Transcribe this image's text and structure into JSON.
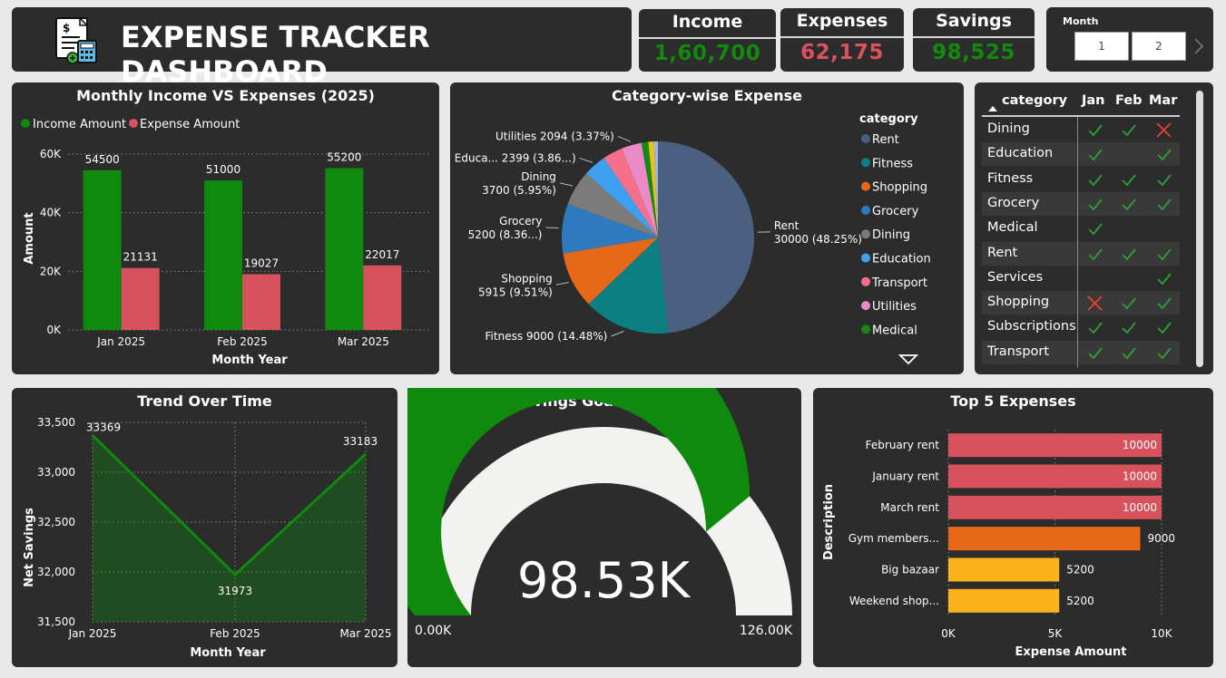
{
  "header": {
    "title": "EXPENSE TRACKER DASHBOARD",
    "icon": "invoice-calculator-icon"
  },
  "kpis": [
    {
      "label": "Income",
      "value": "1,60,700",
      "color": "#118a0e"
    },
    {
      "label": "Expenses",
      "value": "62,175",
      "color": "#d9535e"
    },
    {
      "label": "Savings",
      "value": "98,525",
      "color": "#118a0e"
    }
  ],
  "slicer": {
    "label": "Month",
    "options": [
      "1",
      "2"
    ],
    "next_icon": "chevron-right-icon"
  },
  "colors": {
    "income": "#0f8a0f",
    "expense": "#d6525d",
    "panel": "#2c2c2c"
  },
  "chart_data": [
    {
      "id": "monthly",
      "type": "bar",
      "title": "Monthly Income VS Expenses (2025)",
      "xlabel": "Month Year",
      "ylabel": "Amount",
      "categories": [
        "Jan 2025",
        "Feb 2025",
        "Mar 2025"
      ],
      "series": [
        {
          "name": "Income Amount",
          "color": "#0f8a0f",
          "values": [
            54500,
            51000,
            55200
          ]
        },
        {
          "name": "Expense Amount",
          "color": "#d6525d",
          "values": [
            21131,
            19027,
            22017
          ]
        }
      ],
      "ylim": [
        0,
        60000
      ],
      "yticks": [
        "0K",
        "20K",
        "40K",
        "60K"
      ],
      "grid": true,
      "legend": "top-left"
    },
    {
      "id": "category",
      "type": "pie",
      "title": "Category-wise Expense",
      "legend_title": "category",
      "slices": [
        {
          "name": "Rent",
          "value": 30000,
          "pct": "48.25%",
          "color": "#4b5f80",
          "label": "Rent 30000 (48.25%)"
        },
        {
          "name": "Fitness",
          "value": 9000,
          "pct": "14.48%",
          "color": "#0c7f82",
          "label": "Fitness 9000 (14.48%)"
        },
        {
          "name": "Shopping",
          "value": 5915,
          "pct": "9.51%",
          "color": "#e8681a",
          "label": "Shopping 5915 (9.51%)"
        },
        {
          "name": "Grocery",
          "value": 5200,
          "pct": "8.36...",
          "color": "#2d7bbd",
          "label": "Grocery 5200 (8.36...)"
        },
        {
          "name": "Dining",
          "value": 3700,
          "pct": "5.95%",
          "color": "#7b7b7b",
          "label": "Dining 3700 (5.95%)"
        },
        {
          "name": "Education",
          "value": 2399,
          "pct": "3.86...",
          "color": "#3ea0f0",
          "label": "Educa... 2399 (3.86...)"
        },
        {
          "name": "Transport",
          "value": 2094,
          "pct": "3.37%",
          "color": "#f5718a",
          "label": ""
        },
        {
          "name": "Utilities",
          "value": 2094,
          "pct": "3.37%",
          "color": "#ea8ac9",
          "label": "Utilities 2094 (3.37%)"
        },
        {
          "name": "Medical",
          "value": 700,
          "pct": "1.13%",
          "color": "#138a12",
          "label": ""
        },
        {
          "name": "Services",
          "value": 600,
          "pct": "0.97%",
          "color": "#e8c21a",
          "label": ""
        },
        {
          "name": "Subscriptions",
          "value": 400,
          "pct": "0.64%",
          "color": "#9bb9e6",
          "label": ""
        }
      ],
      "legend_items": [
        "Rent",
        "Fitness",
        "Shopping",
        "Grocery",
        "Dining",
        "Education",
        "Transport",
        "Utilities",
        "Medical"
      ],
      "legend": "right"
    },
    {
      "id": "matrix",
      "type": "table",
      "columns": [
        "category",
        "Jan",
        "Feb",
        "Mar"
      ],
      "rows": [
        {
          "category": "Dining",
          "cells": [
            "check",
            "check",
            "cross"
          ]
        },
        {
          "category": "Education",
          "cells": [
            "check",
            "",
            "check"
          ]
        },
        {
          "category": "Fitness",
          "cells": [
            "check",
            "check",
            "check"
          ]
        },
        {
          "category": "Grocery",
          "cells": [
            "check",
            "check",
            "check"
          ]
        },
        {
          "category": "Medical",
          "cells": [
            "check",
            "",
            ""
          ]
        },
        {
          "category": "Rent",
          "cells": [
            "check",
            "check",
            "check"
          ]
        },
        {
          "category": "Services",
          "cells": [
            "",
            "",
            "check"
          ]
        },
        {
          "category": "Shopping",
          "cells": [
            "cross",
            "check",
            "check"
          ]
        },
        {
          "category": "Subscriptions",
          "cells": [
            "check",
            "check",
            "check"
          ]
        },
        {
          "category": "Transport",
          "cells": [
            "check",
            "check",
            "check"
          ]
        }
      ]
    },
    {
      "id": "trend",
      "type": "area",
      "title": "Trend Over Time",
      "xlabel": "Month Year",
      "ylabel": "Net Savings",
      "x": [
        "Jan 2025",
        "Feb 2025",
        "Mar 2025"
      ],
      "values": [
        33369,
        31973,
        33183
      ],
      "ylim": [
        31500,
        33500
      ],
      "yticks": [
        "31,500",
        "32,000",
        "32,500",
        "33,000",
        "33,500"
      ],
      "color": "#0f8a0f",
      "grid": true
    },
    {
      "id": "gauge",
      "type": "gauge",
      "title": "Savings Goal Progress",
      "value": 98525,
      "value_label": "98.53K",
      "min": 0,
      "max": 126000,
      "min_label": "0.00K",
      "max_label": "126.00K",
      "color": "#0f8a0f"
    },
    {
      "id": "top5",
      "type": "bar",
      "orientation": "horizontal",
      "title": "Top 5 Expenses",
      "xlabel": "Expense Amount",
      "ylabel": "Description",
      "categories": [
        "February rent",
        "January rent",
        "March rent",
        "Gym members...",
        "Big bazaar",
        "Weekend shop..."
      ],
      "values": [
        10000,
        10000,
        10000,
        9000,
        5200,
        5200
      ],
      "colors": [
        "#d6525d",
        "#d6525d",
        "#d6525d",
        "#e8681a",
        "#fbb31c",
        "#fbb31c"
      ],
      "xlim": [
        0,
        10000
      ],
      "xticks": [
        "0K",
        "5K",
        "10K"
      ]
    }
  ]
}
